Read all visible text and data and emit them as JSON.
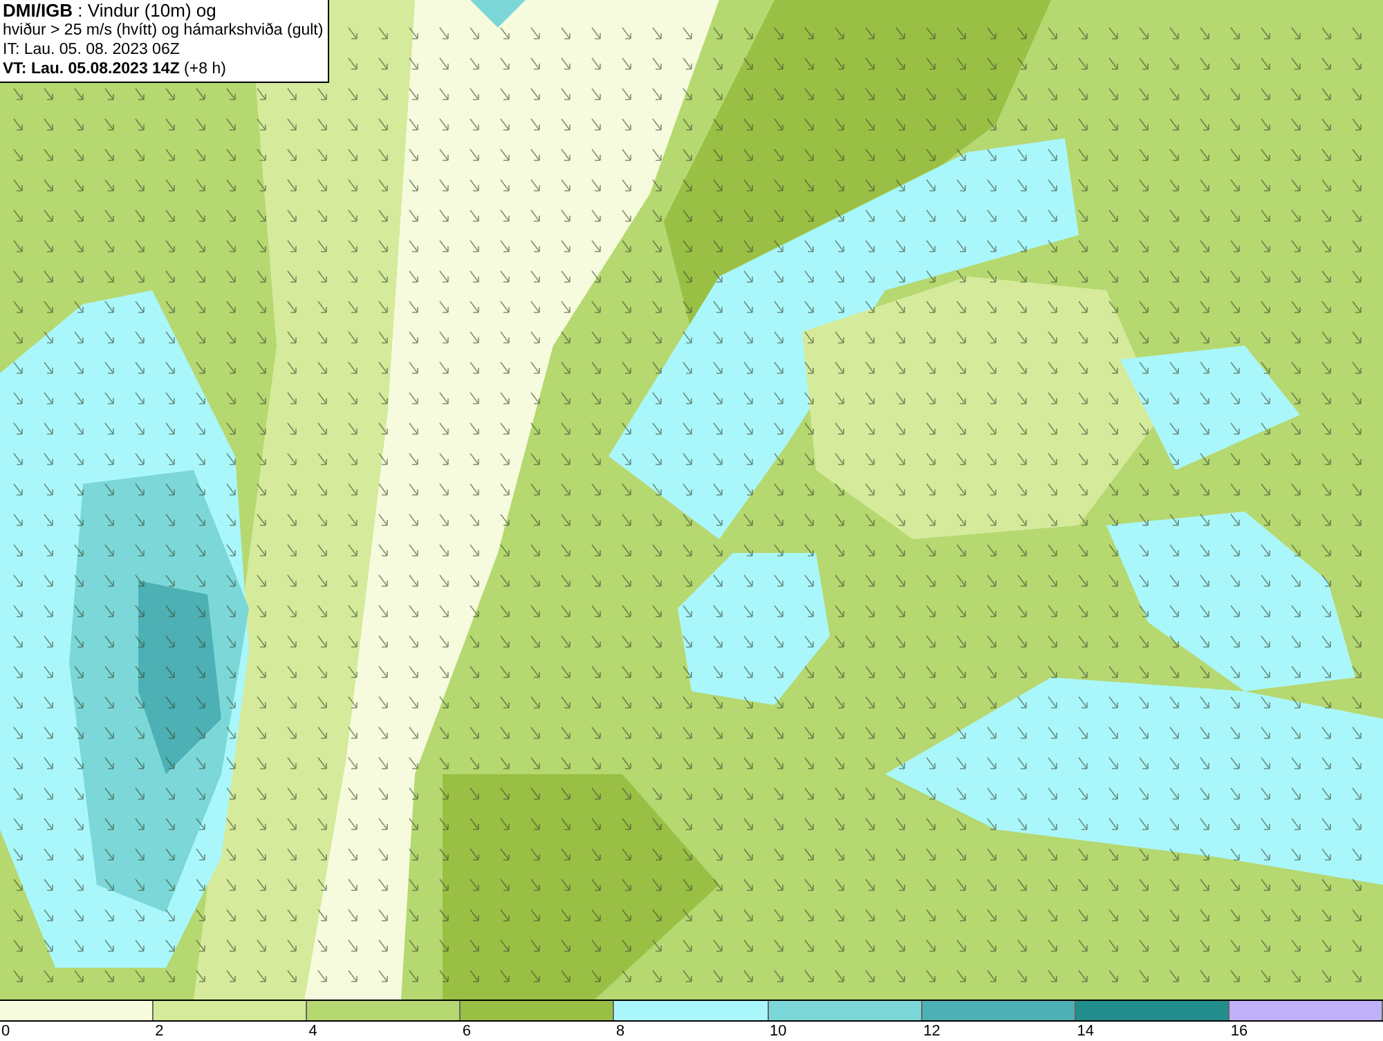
{
  "header": {
    "lines": [
      "**DMI/IGB** : Vindur (10m) og",
      "hviður > 25 m/s (hvítt) og hámarkshviða (gult)",
      "IT: Lau. 05. 08. 2023 06Z",
      "**VT: Lau. 05.08.2023 14Z** (+8 h)"
    ]
  },
  "legend": {
    "items": [
      {
        "color": "#f5fbdc",
        "label": "0"
      },
      {
        "color": "#d5eb9b",
        "label": "2"
      },
      {
        "color": "#b5d870",
        "label": "4"
      },
      {
        "color": "#99c045",
        "label": "6"
      },
      {
        "color": "#aaf7fb",
        "label": "8"
      },
      {
        "color": "#7cd8d8",
        "label": "10"
      },
      {
        "color": "#4cb0b4",
        "label": "12"
      },
      {
        "color": "#228e8e",
        "label": "14"
      },
      {
        "color": "#c0b0f8",
        "label": "16"
      }
    ]
  }
}
